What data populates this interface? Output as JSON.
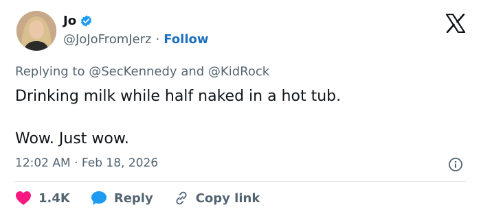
{
  "author": {
    "name": "Jo",
    "handle": "@JoJoFromJerz",
    "separator": "·",
    "follow_label": "Follow"
  },
  "reply_context": {
    "prefix": "Replying to",
    "mention_1": "@SecKennedy",
    "joiner": "and",
    "mention_2": "@KidRock"
  },
  "post": {
    "line_1": "Drinking milk while half naked in a hot tub.",
    "line_2": "Wow. Just wow."
  },
  "timestamp": "12:02 AM · Feb 18, 2026",
  "actions": {
    "like_count": "1.4K",
    "reply_label": "Reply",
    "copy_label": "Copy link"
  },
  "colors": {
    "verified_badge": "#1d9bf0",
    "like": "#f91880",
    "reply_bubble": "#1d9bf0"
  },
  "icons": [
    "verified-badge-icon",
    "x-logo-icon",
    "info-icon",
    "heart-icon",
    "reply-bubble-icon",
    "link-icon"
  ]
}
